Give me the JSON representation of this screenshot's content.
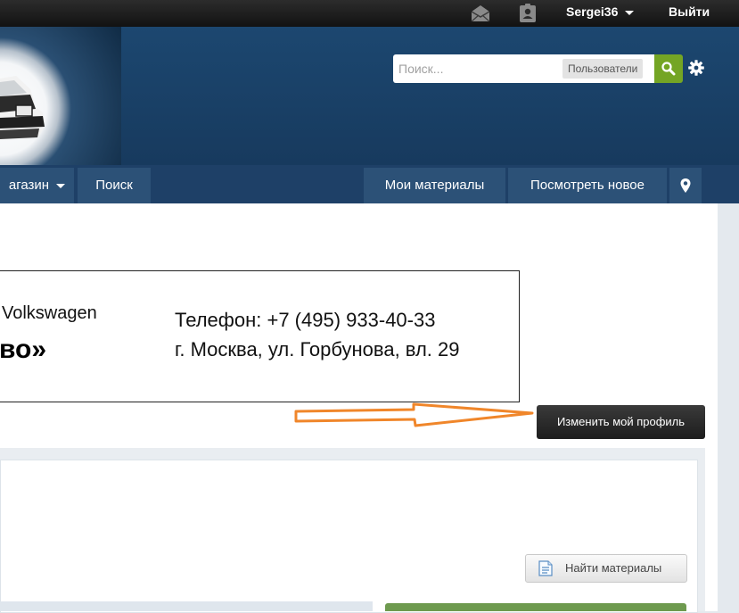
{
  "topbar": {
    "username": "Sergei36",
    "logout_label": "Выйти",
    "icons": [
      "messages-icon",
      "notifications-icon"
    ]
  },
  "search": {
    "placeholder": "Поиск...",
    "value": "",
    "scope_label": "Пользователи"
  },
  "nav": {
    "items_left": [
      {
        "label": "агазин"
      },
      {
        "label": "Поиск"
      }
    ],
    "items_right": [
      {
        "label": "Мои материалы"
      },
      {
        "label": "Посмотреть новое"
      }
    ]
  },
  "banner": {
    "brand": "Volkswagen",
    "name": "во»",
    "phone": "Телефон: +7 (495) 933-40-33",
    "address": "г. Москва,  ул. Горбунова, вл. 29"
  },
  "profile": {
    "edit_label": "Изменить мой профиль"
  },
  "panel": {
    "find_label": "Найти материалы"
  },
  "colors": {
    "topbar": "#1a1a1a",
    "header": "#1b4269",
    "nav": "#1e4067",
    "search_button": "#74a524",
    "annotation_arrow": "#f0862a"
  }
}
